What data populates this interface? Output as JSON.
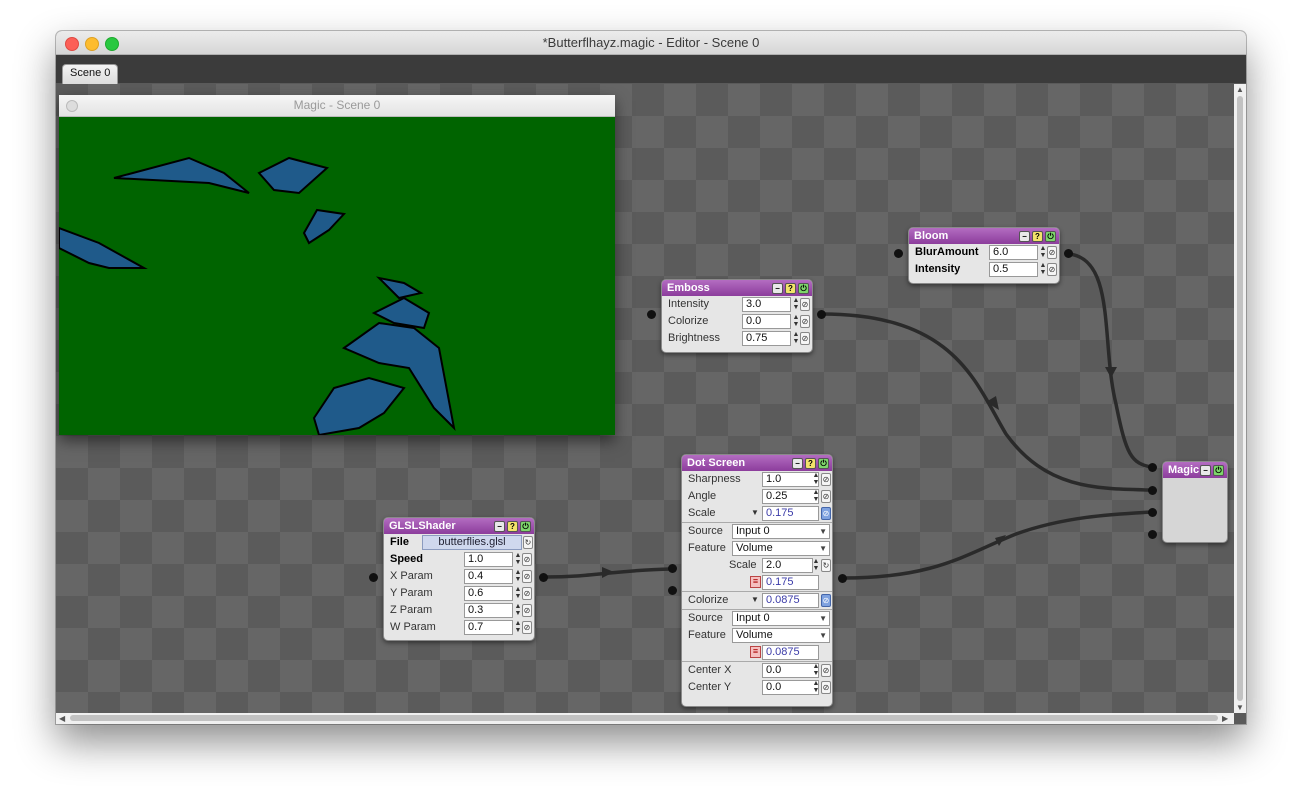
{
  "window": {
    "title": "*Butterflhayz.magic - Editor - Scene 0"
  },
  "tabs": [
    {
      "label": "Scene 0"
    }
  ],
  "viewer": {
    "title": "Magic - Scene 0",
    "bg_color": "#006400"
  },
  "nodes": {
    "bloom": {
      "title": "Bloom",
      "params": [
        {
          "label": "BlurAmount",
          "value": "6.0"
        },
        {
          "label": "Intensity",
          "value": "0.5"
        }
      ]
    },
    "emboss": {
      "title": "Emboss",
      "params": [
        {
          "label": "Intensity",
          "value": "3.0"
        },
        {
          "label": "Colorize",
          "value": "0.0"
        },
        {
          "label": "Brightness",
          "value": "0.75"
        }
      ]
    },
    "glsl": {
      "title": "GLSLShader",
      "file_label": "File",
      "file_value": "butterflies.glsl",
      "params": [
        {
          "label": "Speed",
          "value": "1.0"
        },
        {
          "label": "X Param",
          "value": "0.4"
        },
        {
          "label": "Y Param",
          "value": "0.6"
        },
        {
          "label": "Z Param",
          "value": "0.3"
        },
        {
          "label": "W Param",
          "value": "0.7"
        }
      ]
    },
    "dotscreen": {
      "title": "Dot Screen",
      "sharpness": {
        "label": "Sharpness",
        "value": "1.0"
      },
      "angle": {
        "label": "Angle",
        "value": "0.25"
      },
      "scale": {
        "label": "Scale",
        "value": "0.175"
      },
      "scale_source": {
        "label": "Source",
        "value": "Input 0"
      },
      "scale_feature": {
        "label": "Feature",
        "value": "Volume"
      },
      "scale_sub": {
        "label": "Scale",
        "value": "2.0"
      },
      "scale_result": "0.175",
      "colorize": {
        "label": "Colorize",
        "value": "0.0875"
      },
      "colorize_source": {
        "label": "Source",
        "value": "Input 0"
      },
      "colorize_feature": {
        "label": "Feature",
        "value": "Volume"
      },
      "colorize_result": "0.0875",
      "center_x": {
        "label": "Center X",
        "value": "0.0"
      },
      "center_y": {
        "label": "Center Y",
        "value": "0.0"
      }
    },
    "magic": {
      "title": "Magic"
    }
  },
  "colors": {
    "node_header": "#9b4aab",
    "canvas": "#5b5b5b",
    "wire": "#2a2a2a"
  },
  "icons": {
    "minimize": "minus-icon",
    "help": "help-icon",
    "enable": "power-icon",
    "link": "link-icon",
    "reset": "reset-icon"
  }
}
